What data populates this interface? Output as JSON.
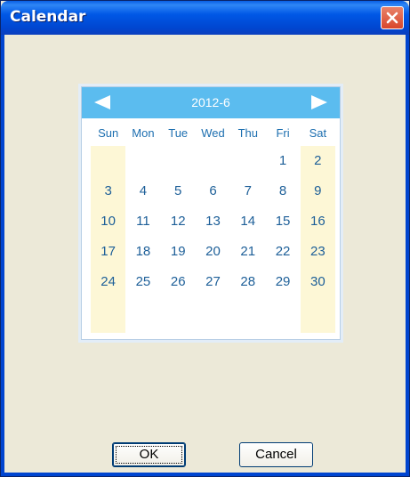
{
  "window": {
    "title": "Calendar"
  },
  "calendar": {
    "month_label": "2012-6",
    "weekdays": [
      "Sun",
      "Mon",
      "Tue",
      "Wed",
      "Thu",
      "Fri",
      "Sat"
    ],
    "weeks": [
      [
        "",
        "",
        "",
        "",
        "",
        "1",
        "2"
      ],
      [
        "3",
        "4",
        "5",
        "6",
        "7",
        "8",
        "9"
      ],
      [
        "10",
        "11",
        "12",
        "13",
        "14",
        "15",
        "16"
      ],
      [
        "17",
        "18",
        "19",
        "20",
        "21",
        "22",
        "23"
      ],
      [
        "24",
        "25",
        "26",
        "27",
        "28",
        "29",
        "30"
      ]
    ]
  },
  "buttons": {
    "ok_label": "OK",
    "cancel_label": "Cancel"
  },
  "colors": {
    "header": "#5bbcef",
    "weekend_bg": "#fdf7d6",
    "day_text": "#1d5f98",
    "title_bar": "#0058e6",
    "close": "#d8462b"
  },
  "icons": {
    "prev": "left-triangle-icon",
    "next": "right-triangle-icon",
    "close": "close-x-icon"
  }
}
